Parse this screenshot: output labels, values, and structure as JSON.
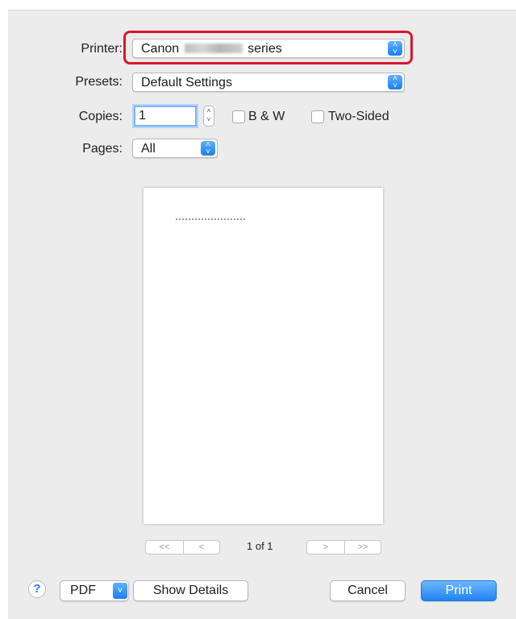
{
  "printer": {
    "label": "Printer:",
    "value_prefix": "Canon",
    "value_suffix": "series"
  },
  "presets": {
    "label": "Presets:",
    "value": "Default Settings"
  },
  "copies": {
    "label": "Copies:",
    "value": "1",
    "bw_label": "B & W",
    "two_sided_label": "Two-Sided",
    "bw_checked": false,
    "two_sided_checked": false
  },
  "pages": {
    "label": "Pages:",
    "value": "All"
  },
  "preview": {
    "page_indicator": "1 of 1",
    "first": "<<",
    "prev": "<",
    "next": ">",
    "last": ">>"
  },
  "bottom": {
    "help": "?",
    "pdf": "PDF",
    "show_details": "Show Details",
    "cancel": "Cancel",
    "print": "Print"
  },
  "icons": {
    "select_arrows": "up-down-chevron-icon",
    "help": "question-icon",
    "menu": "chevron-down-icon"
  },
  "colors": {
    "accent": "#1a7ef0",
    "highlight": "#d6182b"
  }
}
